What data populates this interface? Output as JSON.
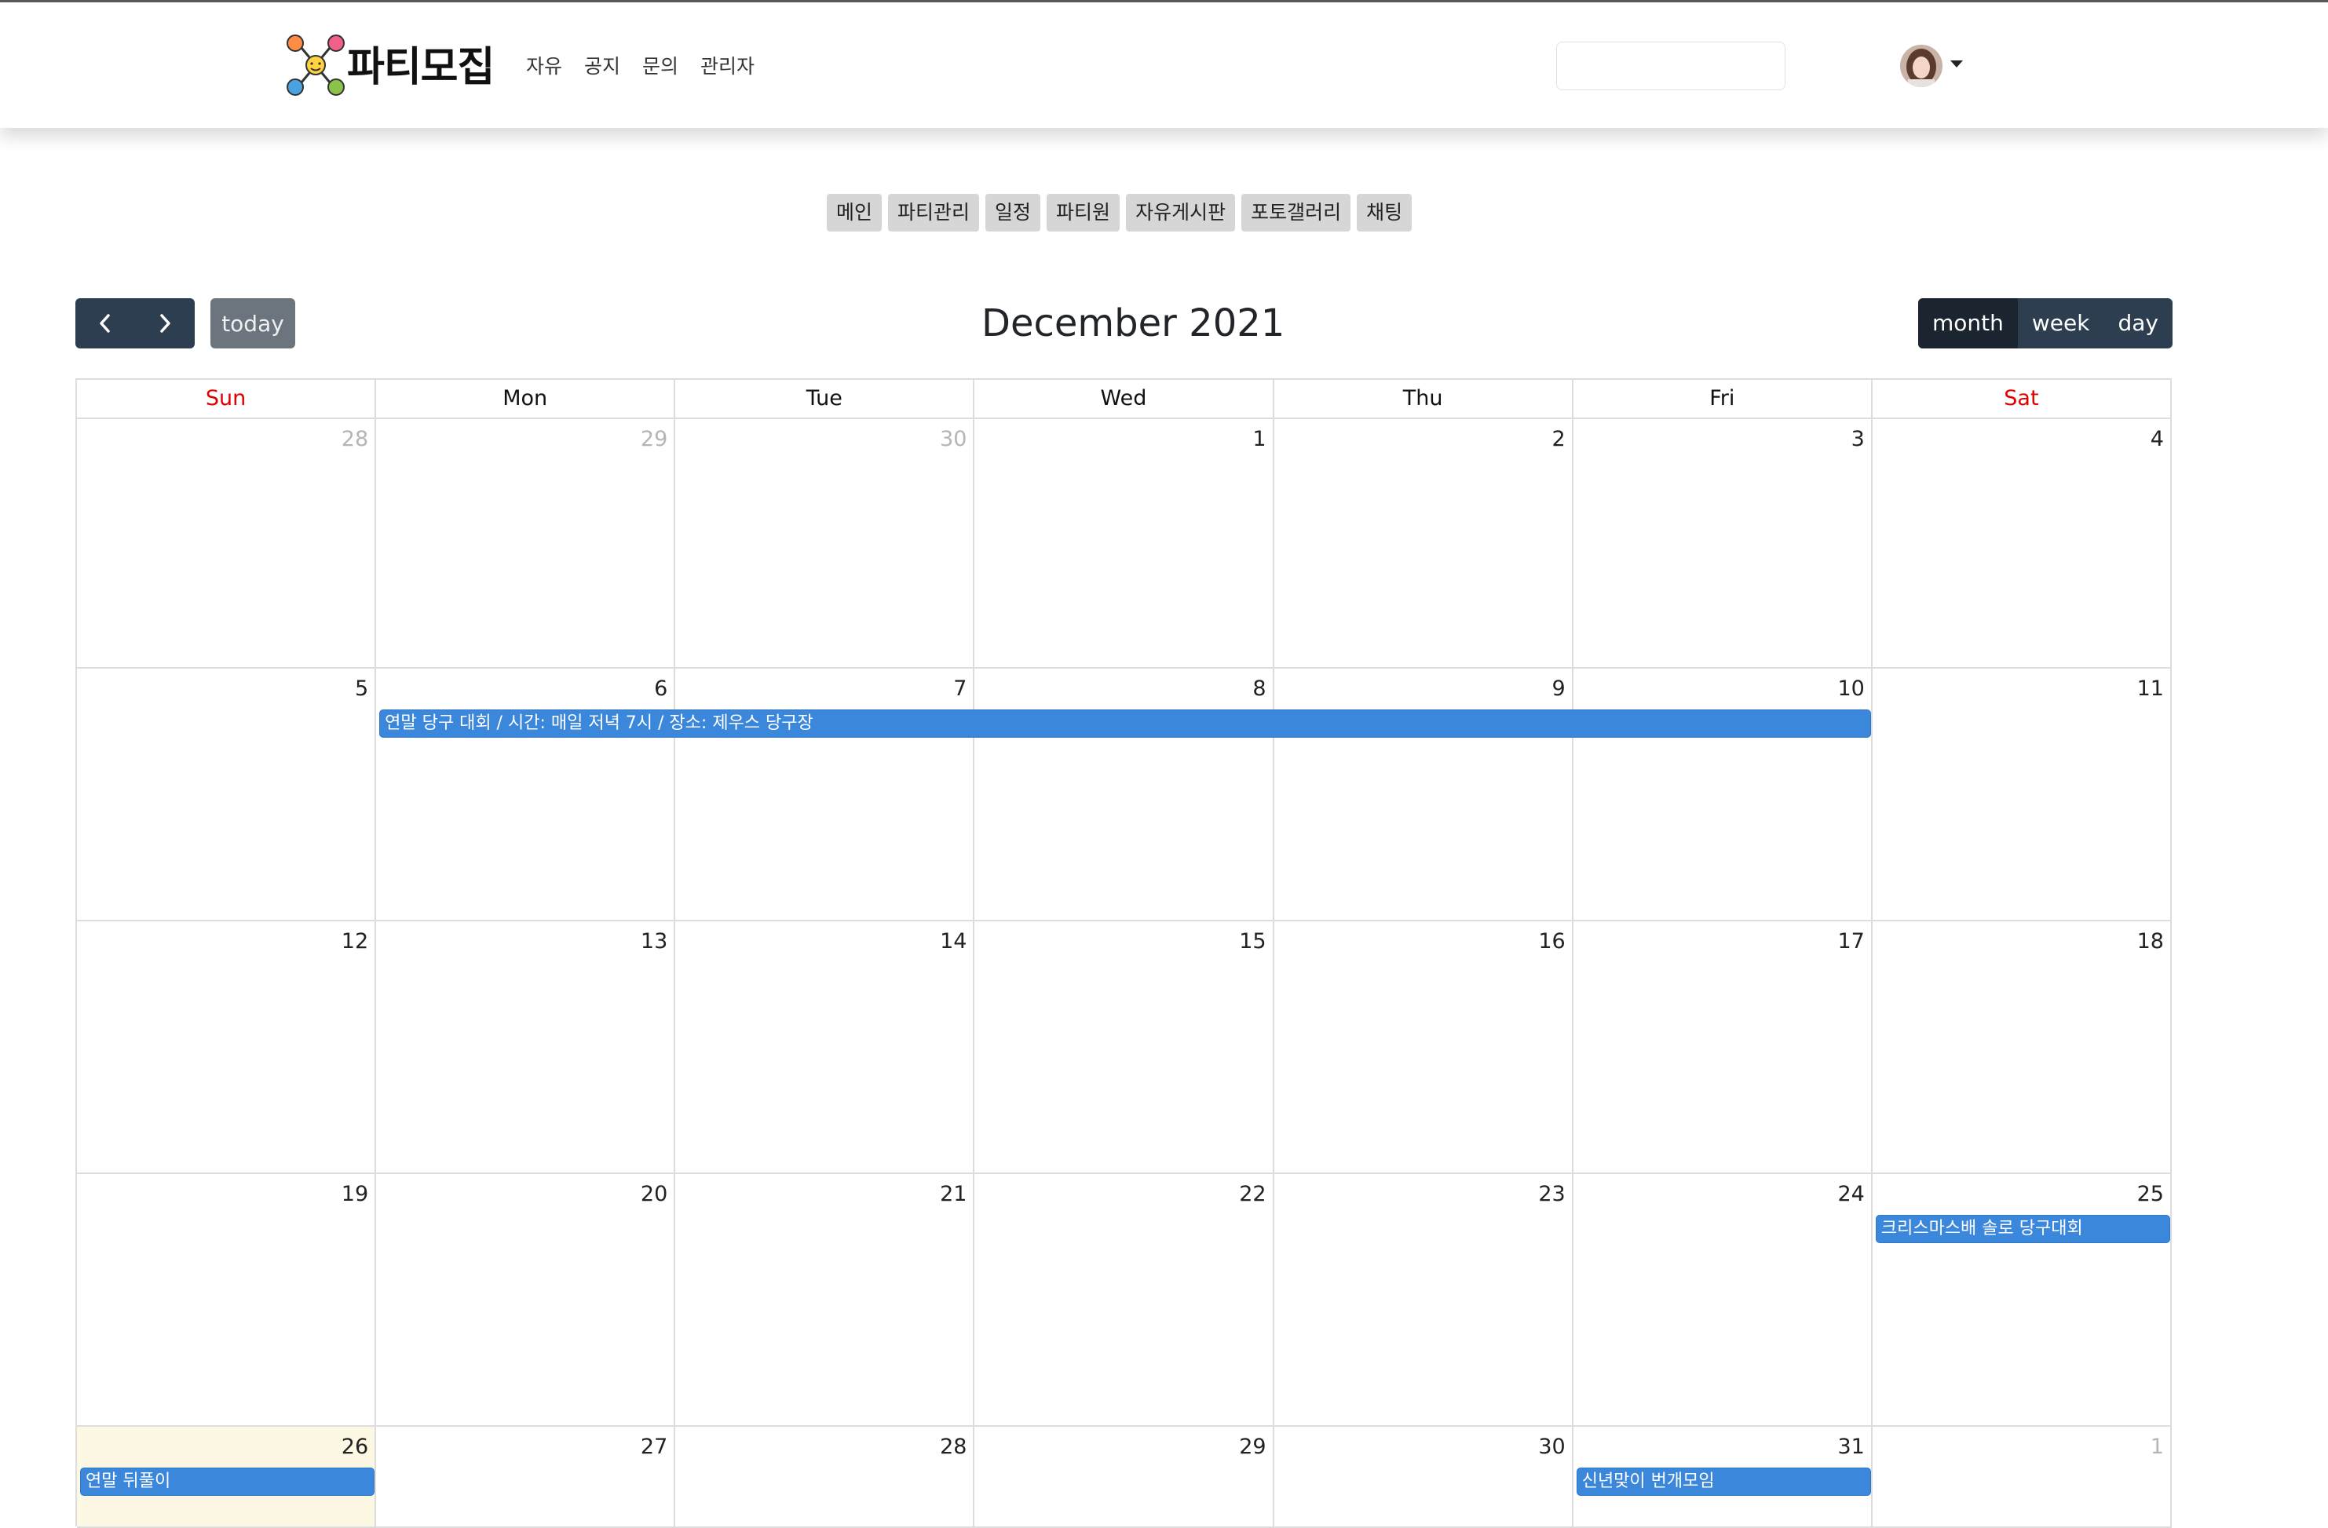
{
  "brand": {
    "name": "파티모집"
  },
  "nav": {
    "links": [
      "자유",
      "공지",
      "문의",
      "관리자"
    ]
  },
  "search": {
    "placeholder": ""
  },
  "subnav": {
    "items": [
      "메인",
      "파티관리",
      "일정",
      "파티원",
      "자유게시판",
      "포토갤러리",
      "채팅"
    ]
  },
  "toolbar": {
    "prev_icon": "chevron-left-icon",
    "next_icon": "chevron-right-icon",
    "today_label": "today",
    "title": "December 2021",
    "views": [
      "month",
      "week",
      "day"
    ],
    "active_view": "month"
  },
  "calendar": {
    "weekdays": [
      "Sun",
      "Mon",
      "Tue",
      "Wed",
      "Thu",
      "Fri",
      "Sat"
    ],
    "weekend_color": "#e00000",
    "event_color": "#3a87dc",
    "today_highlight": "#fcf8e3",
    "weeks": [
      [
        "28",
        "29",
        "30",
        "1",
        "2",
        "3",
        "4"
      ],
      [
        "5",
        "6",
        "7",
        "8",
        "9",
        "10",
        "11"
      ],
      [
        "12",
        "13",
        "14",
        "15",
        "16",
        "17",
        "18"
      ],
      [
        "19",
        "20",
        "21",
        "22",
        "23",
        "24",
        "25"
      ],
      [
        "26",
        "27",
        "28",
        "29",
        "30",
        "31",
        "1"
      ]
    ],
    "other_month_days": [
      [
        0,
        0
      ],
      [
        0,
        1
      ],
      [
        0,
        2
      ],
      [
        4,
        6
      ]
    ],
    "today_cell": [
      4,
      0
    ],
    "events": [
      {
        "title": "연말 당구 대회 / 시간: 매일 저녁 7시 / 장소: 제우스 당구장",
        "start": "2021-12-06",
        "end": "2021-12-10"
      },
      {
        "title": "크리스마스배 솔로 당구대회",
        "start": "2021-12-25",
        "end": "2021-12-25"
      },
      {
        "title": "연말 뒤풀이",
        "start": "2021-12-26",
        "end": "2021-12-26"
      },
      {
        "title": "신년맞이 번개모임",
        "start": "2021-12-31",
        "end": "2021-12-31"
      }
    ]
  }
}
